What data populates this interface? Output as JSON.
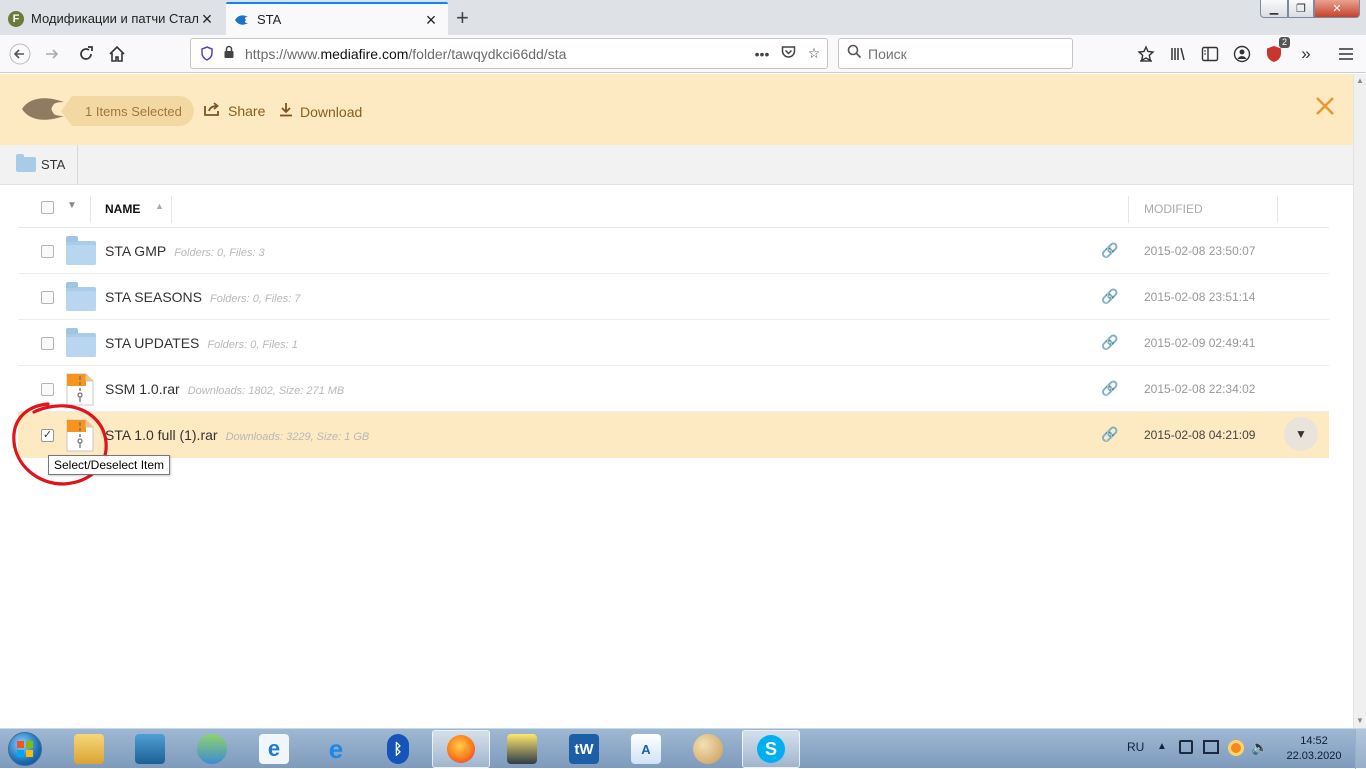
{
  "browser": {
    "tabs": [
      {
        "title": "Модификации и патчи Сталь",
        "active": false
      },
      {
        "title": "STA",
        "active": true
      }
    ],
    "url": {
      "prefix": "https://www.",
      "domain": "mediafire.com",
      "path": "/folder/tawqydkci66dd/sta"
    },
    "search_placeholder": "Поиск",
    "extension_badge": "2",
    "colors": {
      "accent": "#0a84ff"
    }
  },
  "mediafire": {
    "selected_text": "1 Items Selected",
    "share_label": "Share",
    "download_label": "Download",
    "breadcrumb": "STA",
    "header_bg": "#fde9c2",
    "columns": {
      "name": "NAME",
      "modified": "MODIFIED"
    },
    "rows": [
      {
        "name": "STA GMP",
        "meta": "Folders: 0, Files: 3",
        "date": "2015-02-08 23:50:07",
        "type": "folder",
        "selected": false
      },
      {
        "name": "STA SEASONS",
        "meta": "Folders: 0, Files: 7",
        "date": "2015-02-08 23:51:14",
        "type": "folder",
        "selected": false
      },
      {
        "name": "STA UPDATES",
        "meta": "Folders: 0, Files: 1",
        "date": "2015-02-09 02:49:41",
        "type": "folder",
        "selected": false
      },
      {
        "name": "SSM 1.0.rar",
        "meta": "Downloads: 1802, Size: 271 MB",
        "date": "2015-02-08 22:34:02",
        "type": "archive",
        "selected": false
      },
      {
        "name": "STA 1.0 full (1).rar",
        "meta": "Downloads: 3229, Size: 1 GB",
        "date": "2015-02-08 04:21:09",
        "type": "archive",
        "selected": true
      }
    ],
    "tooltip": "Select/Deselect Item"
  },
  "taskbar": {
    "language": "RU",
    "time": "14:52",
    "date": "22.03.2020"
  }
}
